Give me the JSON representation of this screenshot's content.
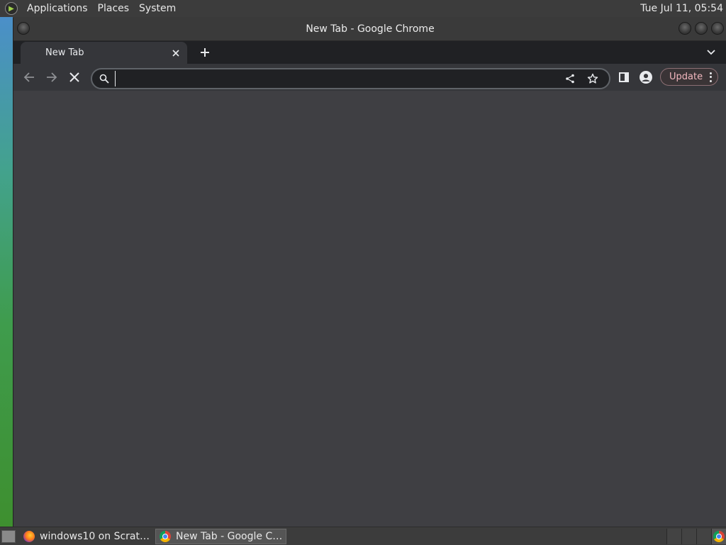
{
  "top_panel": {
    "menus": [
      "Applications",
      "Places",
      "System"
    ],
    "clock": "Tue Jul 11, 05:54"
  },
  "window": {
    "title": "New Tab - Google Chrome"
  },
  "tabs": [
    {
      "title": "New Tab"
    }
  ],
  "toolbar": {
    "address_value": "",
    "update_label": "Update"
  },
  "taskbar": {
    "items": [
      {
        "label": "windows10 on Scrat…",
        "icon": "firefox-icon"
      },
      {
        "label": "New Tab - Google C…",
        "icon": "chrome-icon"
      }
    ]
  },
  "colors": {
    "tabstrip": "#202124",
    "toolbar": "#35363a",
    "content": "#3f3f43",
    "update_text": "#f3b8bf"
  }
}
